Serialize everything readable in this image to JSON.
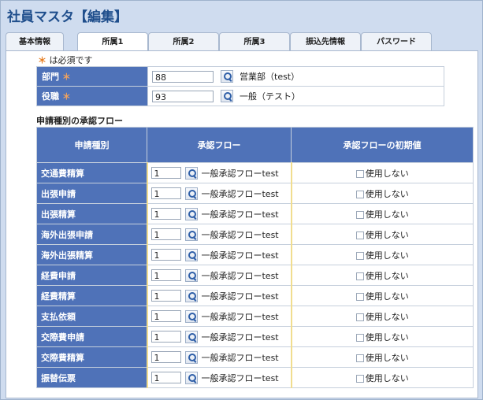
{
  "title": "社員マスタ【編集】",
  "tabs": [
    {
      "label": "基本情報"
    },
    {
      "label": "所属1"
    },
    {
      "label": "所属2"
    },
    {
      "label": "所属3"
    },
    {
      "label": "振込先情報"
    },
    {
      "label": "パスワード"
    }
  ],
  "required_note": {
    "star": "＊",
    "text": "は必須です"
  },
  "form": {
    "department": {
      "label": "部門",
      "star": "＊",
      "value": "88",
      "name": "営業部（test）"
    },
    "position": {
      "label": "役職",
      "star": "＊",
      "value": "93",
      "name": "一般（テスト）"
    }
  },
  "flow_section_title": "申請種別の承認フロー",
  "flow_table": {
    "headers": {
      "type": "申請種別",
      "flow": "承認フロー",
      "default": "承認フローの初期値"
    },
    "rows": [
      {
        "type": "交通費精算",
        "value": "1",
        "flow": "一般承認フローtest",
        "use": "使用しない"
      },
      {
        "type": "出張申請",
        "value": "1",
        "flow": "一般承認フローtest",
        "use": "使用しない"
      },
      {
        "type": "出張精算",
        "value": "1",
        "flow": "一般承認フローtest",
        "use": "使用しない"
      },
      {
        "type": "海外出張申請",
        "value": "1",
        "flow": "一般承認フローtest",
        "use": "使用しない"
      },
      {
        "type": "海外出張精算",
        "value": "1",
        "flow": "一般承認フローtest",
        "use": "使用しない"
      },
      {
        "type": "経費申請",
        "value": "1",
        "flow": "一般承認フローtest",
        "use": "使用しない"
      },
      {
        "type": "経費精算",
        "value": "1",
        "flow": "一般承認フローtest",
        "use": "使用しない"
      },
      {
        "type": "支払依頼",
        "value": "1",
        "flow": "一般承認フローtest",
        "use": "使用しない"
      },
      {
        "type": "交際費申請",
        "value": "1",
        "flow": "一般承認フローtest",
        "use": "使用しない"
      },
      {
        "type": "交際費精算",
        "value": "1",
        "flow": "一般承認フローtest",
        "use": "使用しない"
      },
      {
        "type": "振替伝票",
        "value": "1",
        "flow": "一般承認フローtest",
        "use": "使用しない"
      }
    ]
  }
}
